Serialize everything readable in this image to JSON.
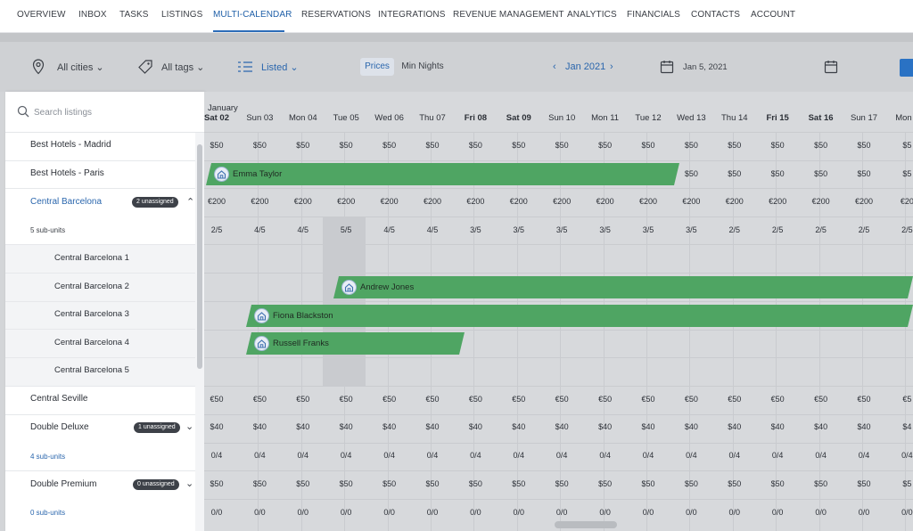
{
  "nav": {
    "items": [
      "OVERVIEW",
      "INBOX",
      "TASKS",
      "LISTINGS",
      "MULTI-CALENDAR",
      "RESERVATIONS",
      "INTEGRATIONS",
      "REVENUE MANAGEMENT",
      "ANALYTICS",
      "FINANCIALS",
      "CONTACTS",
      "ACCOUNT"
    ],
    "active": "MULTI-CALENDAR"
  },
  "toolbar": {
    "cities": "All cities",
    "tags": "All tags",
    "listed": "Listed",
    "prices": "Prices",
    "min_nights": "Min Nights",
    "month": "Jan 2021",
    "date": "Jan 5, 2021"
  },
  "search": {
    "placeholder": "Search listings"
  },
  "listings": [
    {
      "label": "Best Hotels - Madrid"
    },
    {
      "label": "Best Hotels - Paris"
    },
    {
      "label": "Central Barcelona",
      "badge": "2 unassigned",
      "subunits": "5 sub-units"
    },
    {
      "label": "Central Barcelona 1"
    },
    {
      "label": "Central Barcelona 2"
    },
    {
      "label": "Central Barcelona 3"
    },
    {
      "label": "Central Barcelona 4"
    },
    {
      "label": "Central Barcelona 5"
    },
    {
      "label": "Central Seville"
    },
    {
      "label": "Double Deluxe",
      "badge": "1 unassigned",
      "subunits": "4 sub-units"
    },
    {
      "label": "Double Premium",
      "badge": "0 unassigned",
      "subunits": "0 sub-units"
    }
  ],
  "calendar": {
    "month_label": "January",
    "days": [
      "Sat 02",
      "Sun 03",
      "Mon 04",
      "Tue 05",
      "Wed 06",
      "Thu 07",
      "Fri 08",
      "Sat 09",
      "Sun 10",
      "Mon 11",
      "Tue 12",
      "Wed 13",
      "Thu 14",
      "Fri 15",
      "Sat 16",
      "Sun 17",
      "Mon 1"
    ],
    "bold_days": [
      "Sat 02",
      "Fri 08",
      "Sat 09",
      "Fri 15",
      "Sat 16"
    ],
    "rows": {
      "madrid": [
        "$50",
        "$50",
        "$50",
        "$50",
        "$50",
        "$50",
        "$50",
        "$50",
        "$50",
        "$50",
        "$50",
        "$50",
        "$50",
        "$50",
        "$50",
        "$50",
        "$5"
      ],
      "paris_tail": [
        "$50",
        "$50",
        "$50",
        "$50",
        "$50",
        "$5"
      ],
      "barcelona_price": [
        "€200",
        "€200",
        "€200",
        "€200",
        "€200",
        "€200",
        "€200",
        "€200",
        "€200",
        "€200",
        "€200",
        "€200",
        "€200",
        "€200",
        "€200",
        "€200",
        "€20"
      ],
      "barcelona_avail": [
        "2/5",
        "4/5",
        "4/5",
        "5/5",
        "4/5",
        "4/5",
        "3/5",
        "3/5",
        "3/5",
        "3/5",
        "3/5",
        "3/5",
        "2/5",
        "2/5",
        "2/5",
        "2/5",
        "2/5"
      ],
      "seville": [
        "€50",
        "€50",
        "€50",
        "€50",
        "€50",
        "€50",
        "€50",
        "€50",
        "€50",
        "€50",
        "€50",
        "€50",
        "€50",
        "€50",
        "€50",
        "€50",
        "€5"
      ],
      "deluxe_price": [
        "$40",
        "$40",
        "$40",
        "$40",
        "$40",
        "$40",
        "$40",
        "$40",
        "$40",
        "$40",
        "$40",
        "$40",
        "$40",
        "$40",
        "$40",
        "$40",
        "$4"
      ],
      "deluxe_avail": [
        "0/4",
        "0/4",
        "0/4",
        "0/4",
        "0/4",
        "0/4",
        "0/4",
        "0/4",
        "0/4",
        "0/4",
        "0/4",
        "0/4",
        "0/4",
        "0/4",
        "0/4",
        "0/4",
        "0/4"
      ],
      "premium_price": [
        "$50",
        "$50",
        "$50",
        "$50",
        "$50",
        "$50",
        "$50",
        "$50",
        "$50",
        "$50",
        "$50",
        "$50",
        "$50",
        "$50",
        "$50",
        "$50",
        "$5"
      ],
      "premium_avail": [
        "0/0",
        "0/0",
        "0/0",
        "0/0",
        "0/0",
        "0/0",
        "0/0",
        "0/0",
        "0/0",
        "0/0",
        "0/0",
        "0/0",
        "0/0",
        "0/0",
        "0/0",
        "0/0",
        "0/0"
      ]
    },
    "bookings": [
      {
        "guest": "Emma Taylor"
      },
      {
        "guest": "Andrew Jones"
      },
      {
        "guest": "Fiona Blackston"
      },
      {
        "guest": "Russell Franks"
      }
    ]
  },
  "colors": {
    "accent": "#2a66ad",
    "booking": "#4fa563"
  }
}
